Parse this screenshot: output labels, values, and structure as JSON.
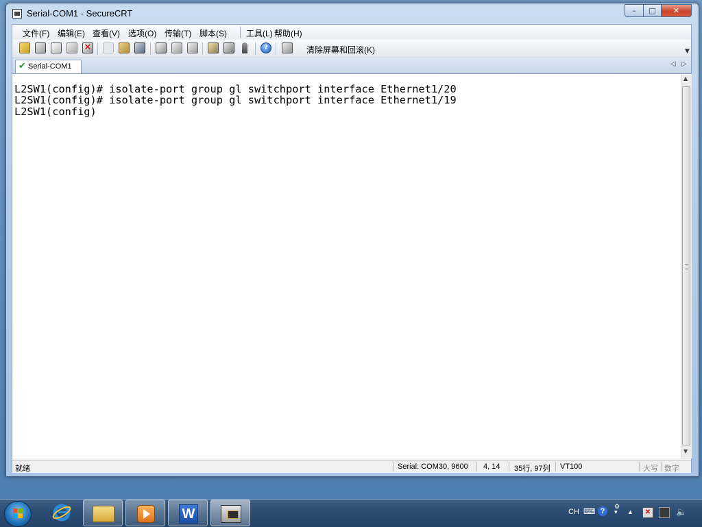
{
  "window": {
    "title": "Serial-COM1 - SecureCRT",
    "controls": {
      "minimize": "–",
      "maximize": "□",
      "close": "✕"
    }
  },
  "menubar": {
    "items": [
      "文件(F)",
      "编辑(E)",
      "查看(V)",
      "选项(O)",
      "传输(T)",
      "脚本(S)",
      "工具(L)",
      "帮助(H)"
    ]
  },
  "toolbar": {
    "clear_label": "清除屏幕和回滚(K)",
    "icons": [
      "connect-icon",
      "quick-connect-icon",
      "connect-in-tab-icon",
      "reconnect-icon",
      "disconnect-icon",
      "copy-icon",
      "paste-icon",
      "find-icon",
      "print-icon",
      "print-selection-icon",
      "print-setup-icon",
      "session-options-icon",
      "global-options-icon",
      "keymap-icon",
      "help-icon",
      "clear-screen-icon"
    ]
  },
  "tabs": [
    {
      "label": "Serial-COM1",
      "active": true
    }
  ],
  "terminal": {
    "lines": [
      "L2SW1(config)# isolate-port group gl switchport interface Ethernet1/20",
      "L2SW1(config)# isolate-port group gl switchport interface Ethernet1/19",
      "L2SW1(config)"
    ]
  },
  "statusbar": {
    "status": "就绪",
    "connection": "Serial: COM30, 9600",
    "cursor": "4,  14",
    "size": "35行, 97列",
    "emulation": "VT100",
    "caps": "大写",
    "num": "数字"
  },
  "taskbar": {
    "tray_lang": "CH"
  },
  "colors": {
    "terminal_bg": "#ffffff",
    "terminal_fg": "#000000",
    "taskbar": "#2a4b72"
  }
}
